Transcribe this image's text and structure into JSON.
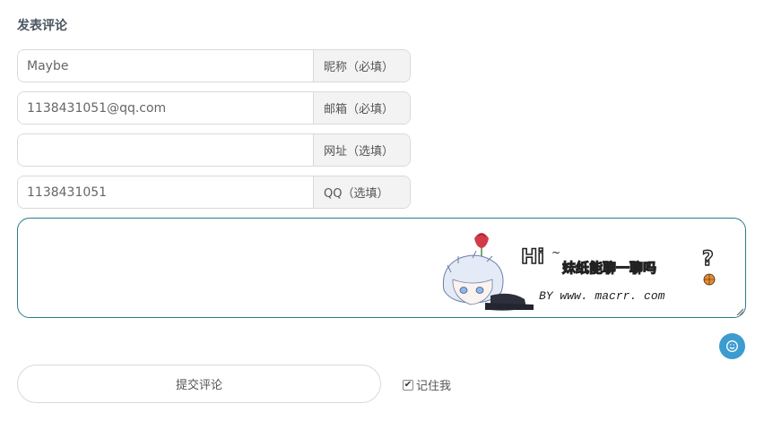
{
  "section": {
    "title": "发表评论"
  },
  "fields": [
    {
      "value": "Maybe",
      "label": "昵称（必填）"
    },
    {
      "value": "1138431051@qq.com",
      "label": "邮箱（必填）"
    },
    {
      "value": "",
      "label": "网址（选填）"
    },
    {
      "value": "1138431051",
      "label": "QQ（选填）"
    }
  ],
  "comment": {
    "value": "",
    "banner_hi": "Hi",
    "banner_text": "妹纸能聊一聊吗",
    "banner_question": "?",
    "banner_by": "BY www. macrr. com"
  },
  "emoji_button": {
    "icon": "smiley-icon"
  },
  "submit": {
    "label": "提交评论"
  },
  "remember": {
    "label": "记住我",
    "checked": true
  },
  "colors": {
    "focus_border": "#2b7d87",
    "emoji_bg": "#3c9bd0",
    "addon_bg": "#f3f3f3"
  }
}
